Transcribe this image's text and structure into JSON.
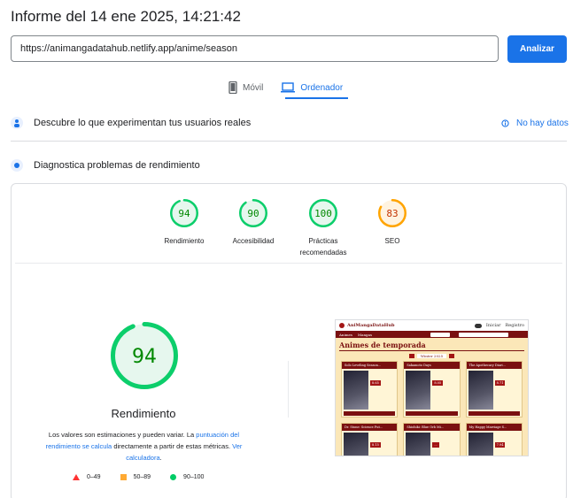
{
  "header": {
    "title": "Informe del 14 ene 2025, 14:21:42"
  },
  "search": {
    "url": "https://animangadatahub.netlify.app/anime/season",
    "button": "Analizar"
  },
  "device_tabs": [
    {
      "label": "Móvil",
      "icon": "phone-icon",
      "active": false
    },
    {
      "label": "Ordenador",
      "icon": "laptop-icon",
      "active": true
    }
  ],
  "field_data": {
    "heading": "Descubre lo que experimentan tus usuarios reales",
    "status": "No hay datos"
  },
  "lab_data": {
    "heading": "Diagnostica problemas de rendimiento"
  },
  "scores": [
    {
      "value": "94",
      "label": "Rendimiento",
      "color": "#0cce6b",
      "fraction": 0.94
    },
    {
      "value": "90",
      "label": "Accesibilidad",
      "color": "#0cce6b",
      "fraction": 0.9
    },
    {
      "value": "100",
      "label": "Prácticas recomendadas",
      "color": "#0cce6b",
      "fraction": 1.0
    },
    {
      "value": "83",
      "label": "SEO",
      "color": "#ffa400",
      "fraction": 0.83
    }
  ],
  "performance": {
    "score": "94",
    "fraction": 0.94,
    "label": "Rendimiento",
    "note_pre": "Los valores son estimaciones y pueden variar. La ",
    "note_link1": "puntuación del rendimiento se calcula",
    "note_mid": " directamente a partir de estas métricas. ",
    "note_link2": "Ver calculadora",
    "note_end": "."
  },
  "legend": [
    {
      "range": "0–49",
      "shape": "triangle",
      "color": "#ff3333"
    },
    {
      "range": "50–89",
      "shape": "square",
      "color": "#ffaa33"
    },
    {
      "range": "90–100",
      "shape": "circle",
      "color": "#00cc66"
    }
  ],
  "thumbnail": {
    "site_name": "AniMangaDataHub",
    "login": "Iniciar",
    "register": "Registro",
    "nav": [
      "Animes",
      "Mangas"
    ],
    "heading": "Animes de temporada",
    "season": "Winter 2025",
    "cards": [
      {
        "title": "Solo Leveling Season...",
        "score": "8.65"
      },
      {
        "title": "Sakamoto Days",
        "score": "8.05"
      },
      {
        "title": "The Apothecary Diari...",
        "score": "8.71"
      },
      {
        "title": "Dr. Stone: Science Fut...",
        "score": "8.15"
      },
      {
        "title": "Shiohiki: Blue Orb Mi...",
        "score": "..."
      },
      {
        "title": "My Happy Marriage S...",
        "score": "7.94"
      }
    ]
  }
}
